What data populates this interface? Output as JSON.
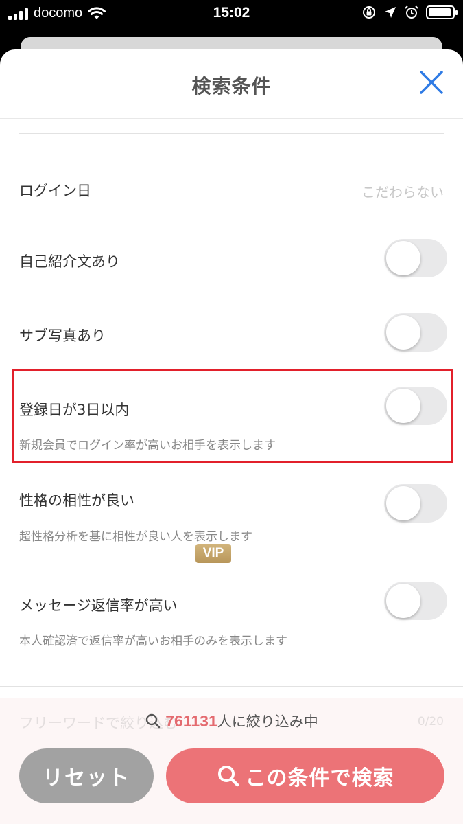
{
  "status_bar": {
    "carrier": "docomo",
    "time": "15:02",
    "battery_level": 0.95
  },
  "sheet": {
    "title": "検索条件"
  },
  "rows": [
    {
      "label": "ログイン日",
      "value": "こだわらない"
    },
    {
      "label": "自己紹介文あり",
      "toggle_on": false
    },
    {
      "label": "サブ写真あり",
      "toggle_on": false
    },
    {
      "label": "登録日が3日以内",
      "description": "新規会員でログイン率が高いお相手を表示します",
      "toggle_on": false,
      "highlighted": true
    },
    {
      "label": "性格の相性が良い",
      "description": "超性格分析を基に相性が良い人を表示します",
      "toggle_on": false
    },
    {
      "label": "メッセージ返信率が高い",
      "badge": "VIP",
      "description": "本人確認済で返信率が高いお相手のみを表示します",
      "toggle_on": false
    }
  ],
  "footer": {
    "faded_field_label": "フリーワードで絞り込む",
    "faded_count": "0/20",
    "result_count": "761131",
    "result_suffix": "人に絞り込み中",
    "reset_label": "リセット",
    "search_label": "この条件で検索"
  },
  "colors": {
    "accent": "#ec7377",
    "highlight_border": "#e2202b",
    "close_icon": "#2f7be5",
    "vip_gold": "#c6a66b"
  }
}
